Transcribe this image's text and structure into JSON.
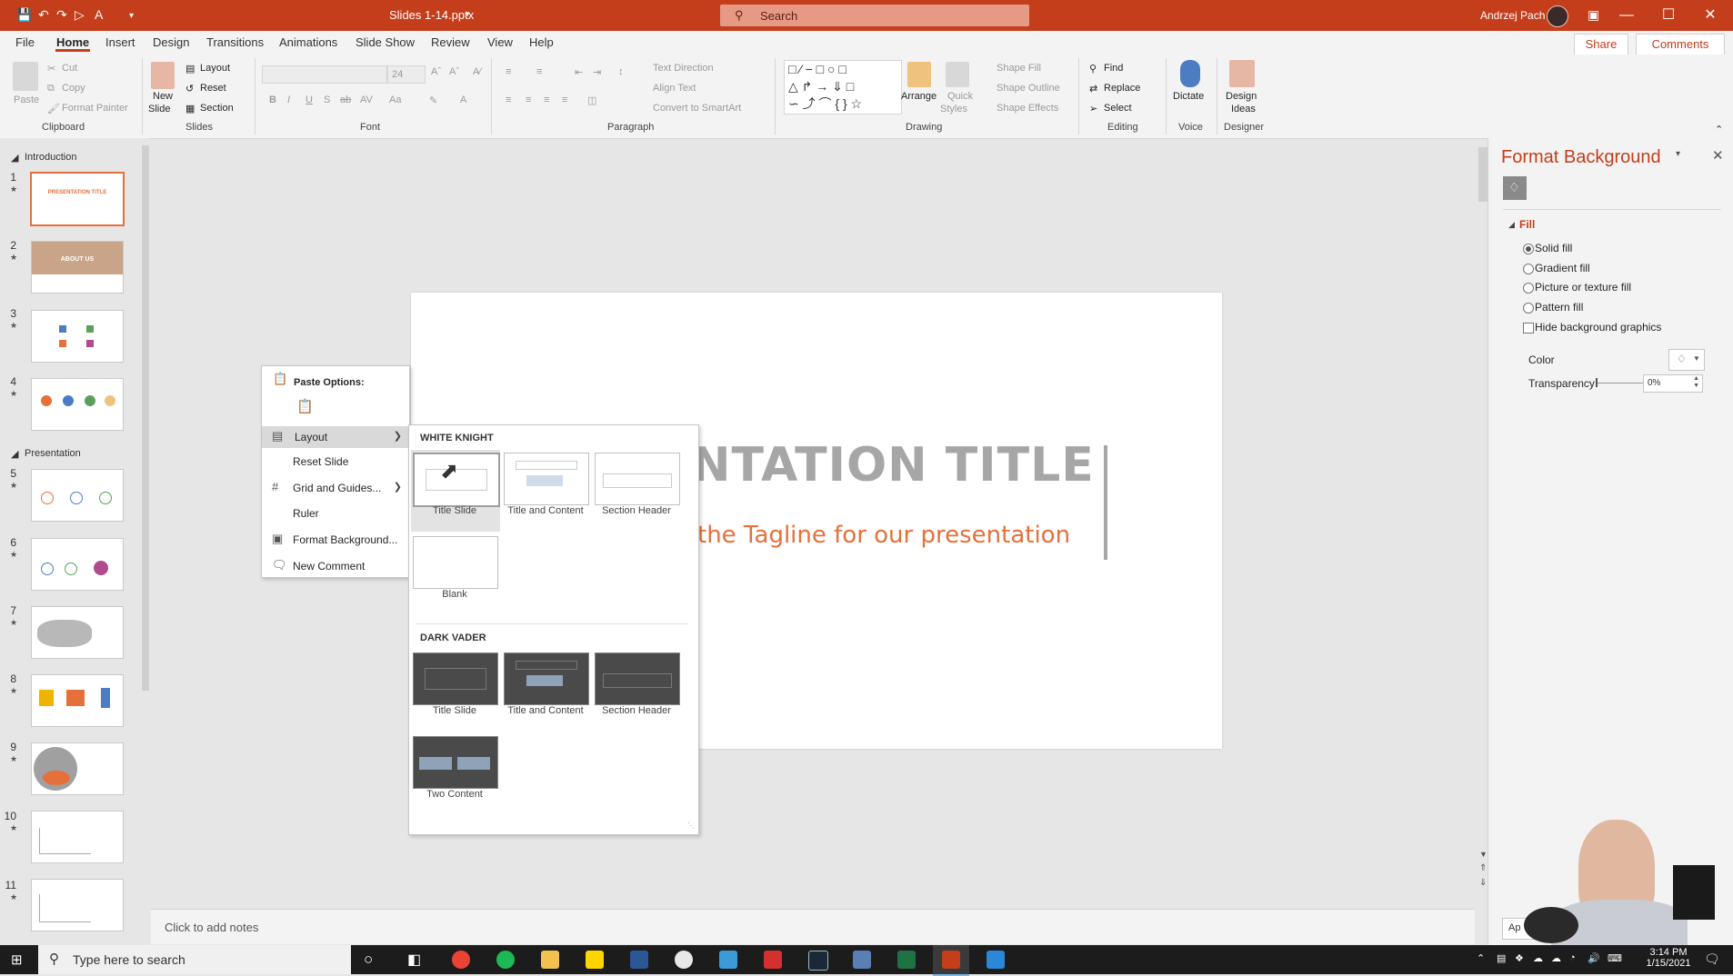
{
  "titlebar": {
    "doc_title": "Slides 1-14.pptx",
    "search_placeholder": "Search",
    "user_name": "Andrzej Pach"
  },
  "ribbon": {
    "tabs": [
      "File",
      "Home",
      "Insert",
      "Design",
      "Transitions",
      "Animations",
      "Slide Show",
      "Review",
      "View",
      "Help"
    ],
    "share_label": "Share",
    "comments_label": "Comments",
    "clipboard": {
      "paste": "Paste",
      "cut": "Cut",
      "copy": "Copy",
      "format_painter": "Format Painter",
      "group": "Clipboard"
    },
    "slides": {
      "new_slide": "New",
      "new_slide2": "Slide",
      "layout": "Layout",
      "reset": "Reset",
      "section": "Section",
      "group": "Slides"
    },
    "font": {
      "font_size": "24",
      "group": "Font"
    },
    "paragraph": {
      "text_direction": "Text Direction",
      "align_text": "Align Text",
      "convert_smartart": "Convert to SmartArt",
      "group": "Paragraph"
    },
    "drawing": {
      "arrange": "Arrange",
      "quick_styles": "Quick",
      "quick_styles2": "Styles",
      "shape_fill": "Shape Fill",
      "shape_outline": "Shape Outline",
      "shape_effects": "Shape Effects",
      "group": "Drawing"
    },
    "editing": {
      "find": "Find",
      "replace": "Replace",
      "select": "Select",
      "group": "Editing"
    },
    "voice": {
      "dictate": "Dictate",
      "group": "Voice"
    },
    "designer": {
      "design_ideas": "Design",
      "design_ideas2": "Ideas",
      "group": "Designer"
    }
  },
  "thumbnails": {
    "sections": [
      "Introduction",
      "Presentation"
    ],
    "slides": [
      "1",
      "2",
      "3",
      "4",
      "5",
      "6",
      "7",
      "8",
      "9",
      "10",
      "11"
    ],
    "slide1_title": "PRESENTATION TITLE",
    "slide2_title": "ABOUT US"
  },
  "slide": {
    "title": "NTATION TITLE",
    "tagline": "the Tagline for our presentation"
  },
  "notes_placeholder": "Click to add notes",
  "context_menu": {
    "paste_options": "Paste Options:",
    "layout": "Layout",
    "reset_slide": "Reset Slide",
    "grid_guides": "Grid and Guides...",
    "ruler": "Ruler",
    "format_background": "Format Background...",
    "new_comment": "New Comment"
  },
  "layout_menu": {
    "group1": "WHITE KNIGHT",
    "group2": "DARK VADER",
    "white_layouts": [
      "Title Slide",
      "Title and Content",
      "Section Header",
      "Blank"
    ],
    "dark_layouts": [
      "Title Slide",
      "Title and Content",
      "Section Header",
      "Two Content"
    ]
  },
  "format_pane": {
    "title": "Format Background",
    "fill_section": "Fill",
    "options": [
      "Solid fill",
      "Gradient fill",
      "Picture or texture fill",
      "Pattern fill"
    ],
    "hide_bg": "Hide background graphics",
    "color_label": "Color",
    "transparency_label": "Transparency",
    "transparency_value": "0%",
    "selected_option": "Solid fill",
    "apply_btn": "Ap"
  },
  "taskbar": {
    "search_placeholder": "Type here to search",
    "time": "3:14 PM",
    "date": "1/15/2021"
  },
  "colors": {
    "accent": "#c43e1c",
    "slide_orange": "#e5703a",
    "title_gray": "#a6a6a6"
  }
}
